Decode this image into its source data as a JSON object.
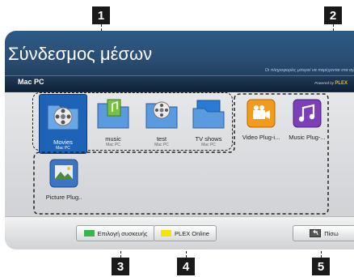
{
  "callouts": [
    "1",
    "2",
    "3",
    "4",
    "5"
  ],
  "header": {
    "title": "Σύνδεσμος μέσων",
    "note": "Οι πληροφορίες μπορεί να παρέχονται στα αγ",
    "device": "Mac PC",
    "powered_label": "Powered by",
    "powered_brand": "PLEX"
  },
  "media": [
    {
      "label": "Movies",
      "sub": "Mac PC",
      "icon": "movies-folder-icon"
    },
    {
      "label": "music",
      "sub": "Mac PC",
      "icon": "music-folder-icon"
    },
    {
      "label": "test",
      "sub": "Mac PC",
      "icon": "test-folder-icon"
    },
    {
      "label": "TV shows",
      "sub": "Mac PC",
      "icon": "tv-folder-icon"
    }
  ],
  "plugins": [
    {
      "label": "Video Plug-i...",
      "icon": "video-plugin-icon",
      "color": "#f29b1c"
    },
    {
      "label": "Music Plug-...",
      "icon": "music-plugin-icon",
      "color": "#7b3fb8"
    },
    {
      "label": "Picture Plug..",
      "icon": "picture-plugin-icon",
      "color": "#3e74c4"
    }
  ],
  "footer": {
    "device_select": {
      "label": "Επιλογή συσκευής",
      "color": "#39b54a"
    },
    "plex_online": {
      "label": "PLEX Online",
      "color": "#f2e500"
    },
    "back": {
      "label": "Πίσω",
      "icon": "back-key-icon"
    }
  },
  "colors": {
    "header_blue": "#2c5a86",
    "selection_blue": "#1d63b8",
    "plex_orange": "#f0b800"
  }
}
